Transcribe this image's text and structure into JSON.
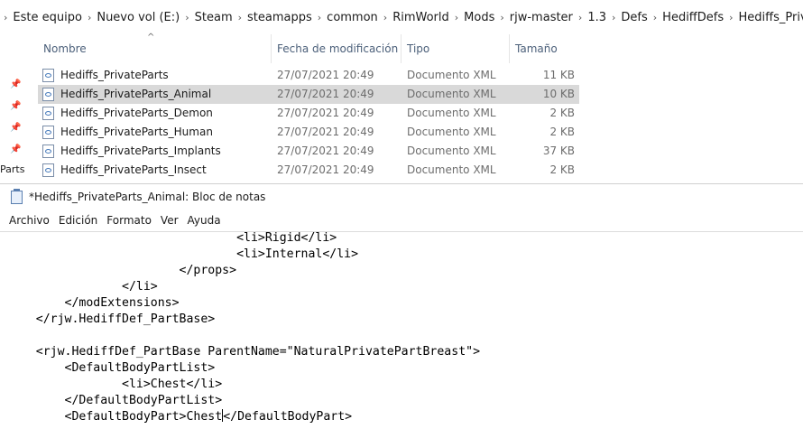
{
  "explorer": {
    "breadcrumb": [
      "Este equipo",
      "Nuevo vol (E:)",
      "Steam",
      "steamapps",
      "common",
      "RimWorld",
      "Mods",
      "rjw-master",
      "1.3",
      "Defs",
      "HediffDefs",
      "Hediffs_PrivateParts"
    ],
    "columns": {
      "name": "Nombre",
      "date": "Fecha de modificación",
      "type": "Tipo",
      "size": "Tamaño"
    },
    "files": [
      {
        "name": "Hediffs_PrivateParts",
        "date": "27/07/2021 20:49",
        "type": "Documento XML",
        "size": "11 KB"
      },
      {
        "name": "Hediffs_PrivateParts_Animal",
        "date": "27/07/2021 20:49",
        "type": "Documento XML",
        "size": "10 KB",
        "selected": true
      },
      {
        "name": "Hediffs_PrivateParts_Demon",
        "date": "27/07/2021 20:49",
        "type": "Documento XML",
        "size": "2 KB"
      },
      {
        "name": "Hediffs_PrivateParts_Human",
        "date": "27/07/2021 20:49",
        "type": "Documento XML",
        "size": "2 KB"
      },
      {
        "name": "Hediffs_PrivateParts_Implants",
        "date": "27/07/2021 20:49",
        "type": "Documento XML",
        "size": "37 KB"
      },
      {
        "name": "Hediffs_PrivateParts_Insect",
        "date": "27/07/2021 20:49",
        "type": "Documento XML",
        "size": "2 KB"
      }
    ],
    "left_cut_text": "Parts"
  },
  "notepad": {
    "title": "*Hediffs_PrivateParts_Animal: Bloc de notas",
    "menu": [
      "Archivo",
      "Edición",
      "Formato",
      "Ver",
      "Ayuda"
    ],
    "lines": [
      "                                <li>Rigid</li>",
      "                                <li>Internal</li>",
      "                        </props>",
      "                </li>",
      "        </modExtensions>",
      "    </rjw.HediffDef_PartBase>",
      "",
      "    <rjw.HediffDef_PartBase ParentName=\"NaturalPrivatePartBreast\">",
      "        <DefaultBodyPartList>",
      "                <li>Chest</li>",
      "        </DefaultBodyPartList>",
      "        <DefaultBodyPart>Chest|</DefaultBodyPart>"
    ]
  }
}
